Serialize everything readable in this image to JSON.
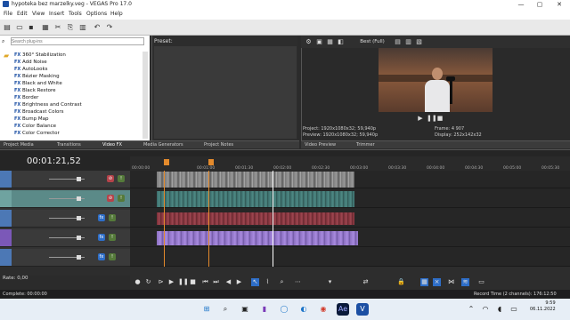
{
  "window": {
    "title": "hypoteka bez marzelky.veg - VEGAS Pro 17.0",
    "controls": {
      "min": "—",
      "max": "▢",
      "close": "✕"
    }
  },
  "menu": [
    "File",
    "Edit",
    "View",
    "Insert",
    "Tools",
    "Options",
    "Help"
  ],
  "explorer": {
    "search_placeholder": "Search plug-ins",
    "items": [
      "360° Stabilization",
      "Add Noise",
      "AutoLooks",
      "Bézier Masking",
      "Black and White",
      "Black Restore",
      "Border",
      "Brightness and Contrast",
      "Broadcast Colors",
      "Bump Map",
      "Color Balance",
      "Color Corrector"
    ],
    "fx_tag": "FX"
  },
  "presets_label": "Preset:",
  "tabs_left": [
    "Project Media",
    "Transitions",
    "Video FX",
    "Media Generators",
    "Project Notes"
  ],
  "preview": {
    "quality": "Best (Full)",
    "project": "Project:   1920x1080x32; 59,940p",
    "preview": "Preview:   1920x1080x32; 59,940p",
    "frame_label": "Frame:",
    "frame": "4 907",
    "display_label": "Display:",
    "display": "252x142x32"
  },
  "tabs_right": [
    "Video Preview",
    "Trimmer"
  ],
  "timeline": {
    "timecode": "00:01:21,52",
    "ruler": [
      "00:00:00",
      "00:01:00",
      "00:01:30",
      "00:02:00",
      "00:02:30",
      "00:03:00",
      "00:03:30",
      "00:04:00",
      "00:04:30",
      "00:05:00",
      "00:05:30"
    ],
    "rate": "Rate: 0,00"
  },
  "status": {
    "left": "Complete: 00:00:00",
    "right": "Record Time (2 channels): 176:12:50"
  },
  "clock": {
    "time": "9:59",
    "date": "06.11.2022"
  },
  "colors": {
    "accent": "#e38a2c",
    "audio": "#3a6b69",
    "purple": "#8a6fc0",
    "red": "#7a2d35"
  }
}
